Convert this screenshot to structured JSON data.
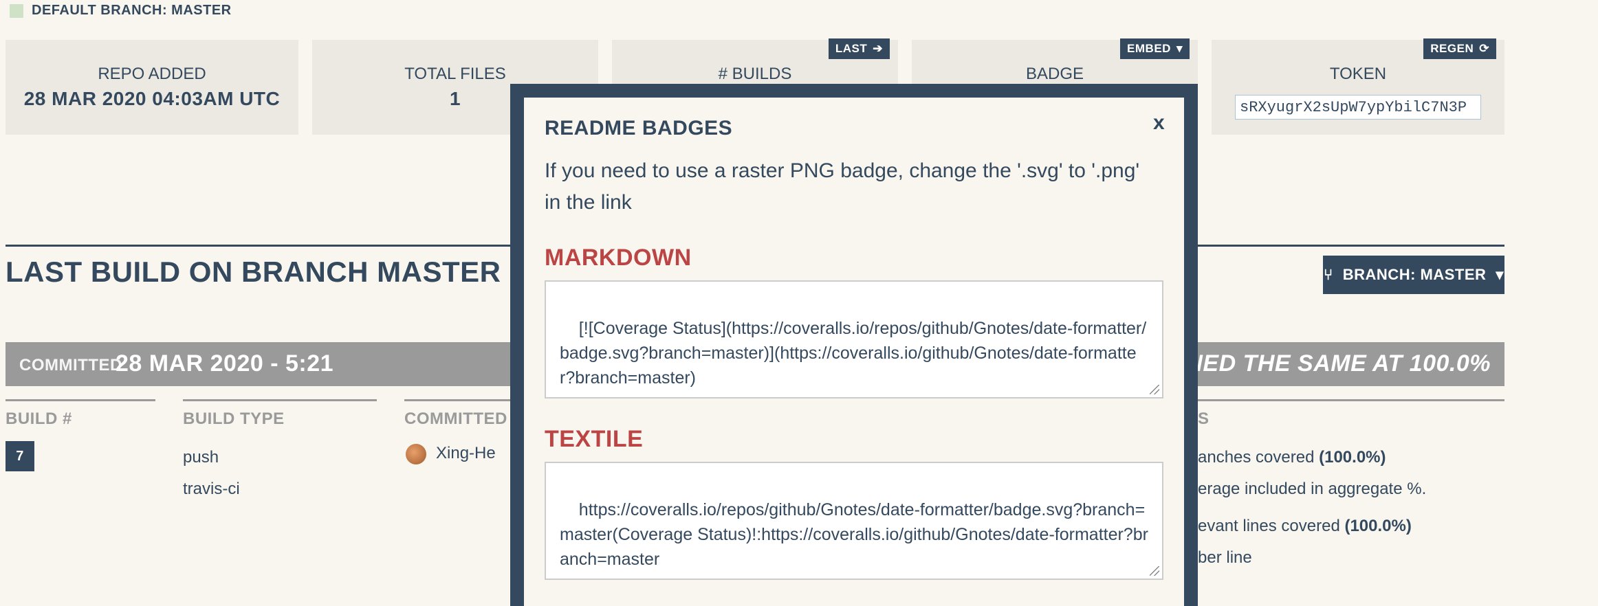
{
  "top": {
    "default_branch": "DEFAULT BRANCH: MASTER"
  },
  "stats": [
    {
      "label": "REPO ADDED",
      "value": "28 MAR 2020 04:03AM UTC"
    },
    {
      "label": "TOTAL FILES",
      "value": "1"
    },
    {
      "label": "# BUILDS",
      "value": "",
      "button": "LAST"
    },
    {
      "label": "BADGE",
      "value": "",
      "button": "EMBED"
    },
    {
      "label": "TOKEN",
      "token": "sRXyugrX2sUpW7ypYbilC7N3P",
      "button": "REGEN"
    }
  ],
  "section": {
    "title": "LAST BUILD ON BRANCH MASTER",
    "branch_button": "BRANCH: MASTER"
  },
  "commit_bar": {
    "label": "COMMITTED",
    "datetime": "28 MAR 2020 - 5:21",
    "right_text": "REMAINED THE SAME AT 100.0%"
  },
  "table": {
    "headers": [
      "BUILD #",
      "BUILD TYPE",
      "COMMITTED BY",
      "S"
    ],
    "build_number": "7",
    "build_type": [
      "push",
      "travis-ci"
    ],
    "committer": "Xing-He",
    "right_lines": [
      {
        "text": "anches covered ",
        "bold": "(100.0%)"
      },
      {
        "text": "erage included in aggregate %.",
        "bold": ""
      },
      {
        "text": "evant lines covered ",
        "bold": "(100.0%)"
      },
      {
        "text": "ber line",
        "bold": ""
      }
    ]
  },
  "modal": {
    "title": "README BADGES",
    "close": "x",
    "description": "If you need to use a raster PNG badge, change the '.svg' to '.png' in the link",
    "markdown_heading": "MARKDOWN",
    "markdown_code": "[![Coverage Status](https://coveralls.io/repos/github/Gnotes/date-formatter/badge.svg?branch=master)](https://coveralls.io/github/Gnotes/date-formatter?branch=master)",
    "textile_heading": "TEXTILE",
    "textile_code": "https://coveralls.io/repos/github/Gnotes/date-formatter/badge.svg?branch=master(Coverage Status)!:https://coveralls.io/github/Gnotes/date-formatter?branch=master"
  },
  "colors": {
    "navy": "#34495e",
    "grey_bar": "#9a9a9a",
    "heading_red": "#b44"
  }
}
